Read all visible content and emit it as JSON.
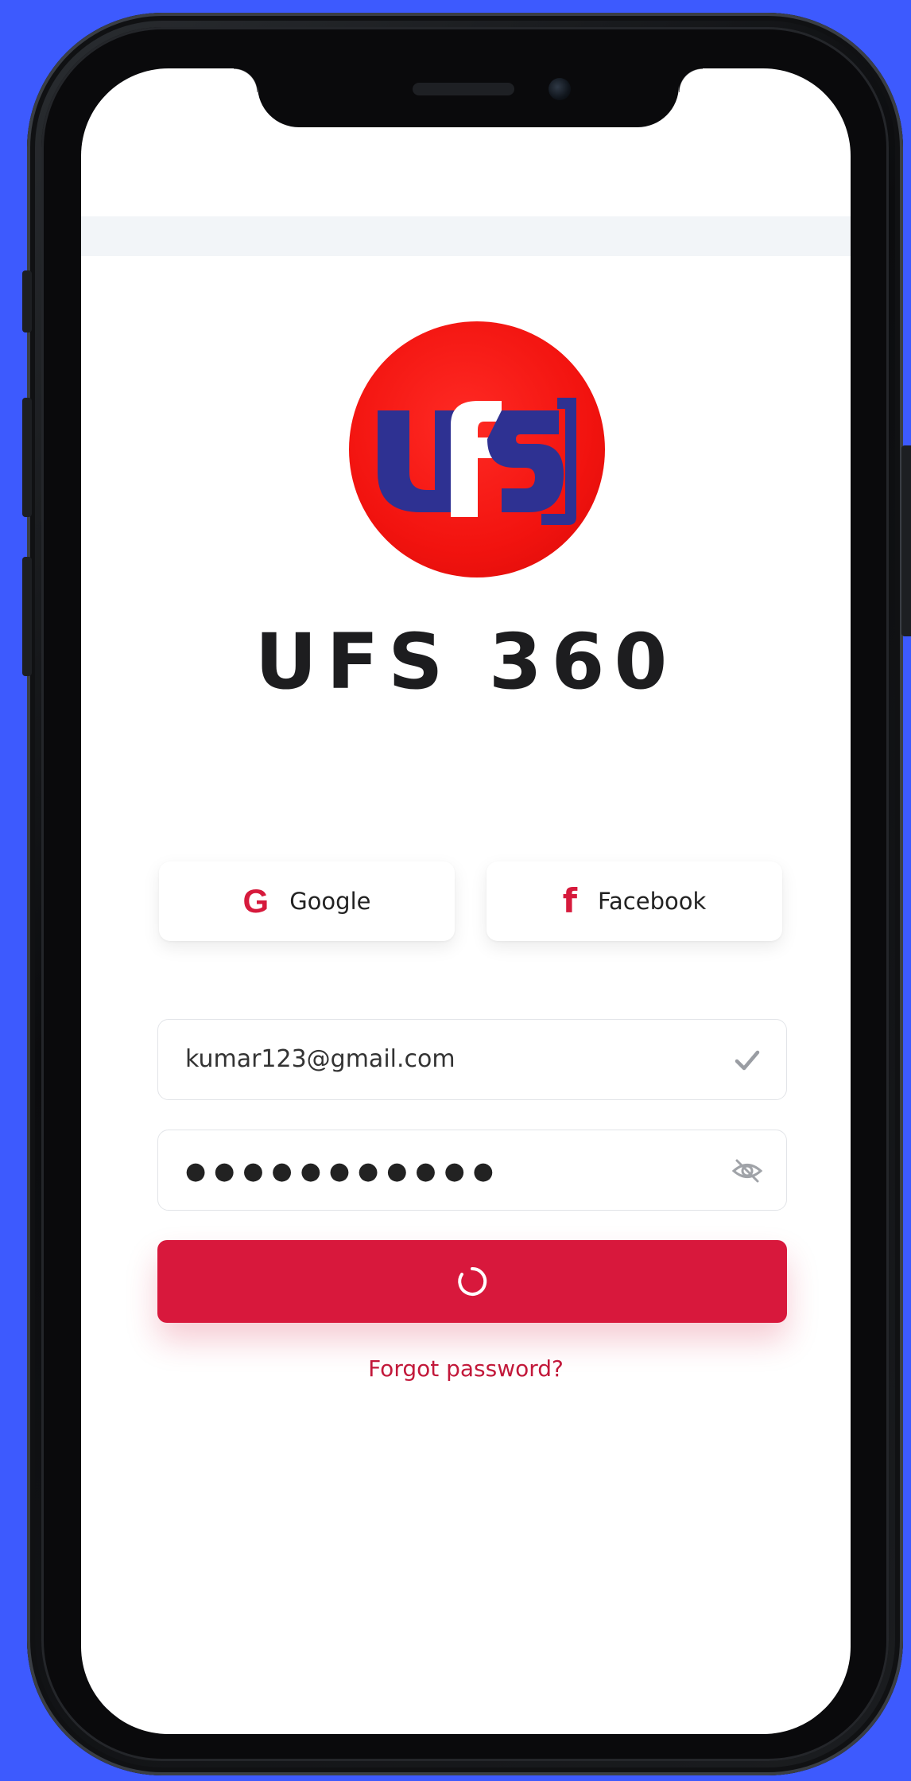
{
  "app": {
    "title": "UFS 360",
    "logo_text": "UFS"
  },
  "social": {
    "google_label": "Google",
    "google_icon_glyph": "G",
    "facebook_label": "Facebook",
    "facebook_icon_glyph": "f"
  },
  "form": {
    "email_value": "kumar123@gmail.com",
    "password_mask": "●●●●●●●●●●●",
    "email_status_icon": "check-icon",
    "password_visibility_icon": "eye-off-icon",
    "submit_state_icon": "loading-spinner-icon"
  },
  "links": {
    "forgot_password": "Forgot password?"
  },
  "colors": {
    "background": "#3d5afe",
    "accent": "#d8183c",
    "logo_red": "#f2130f",
    "logo_navy": "#2e3192"
  }
}
